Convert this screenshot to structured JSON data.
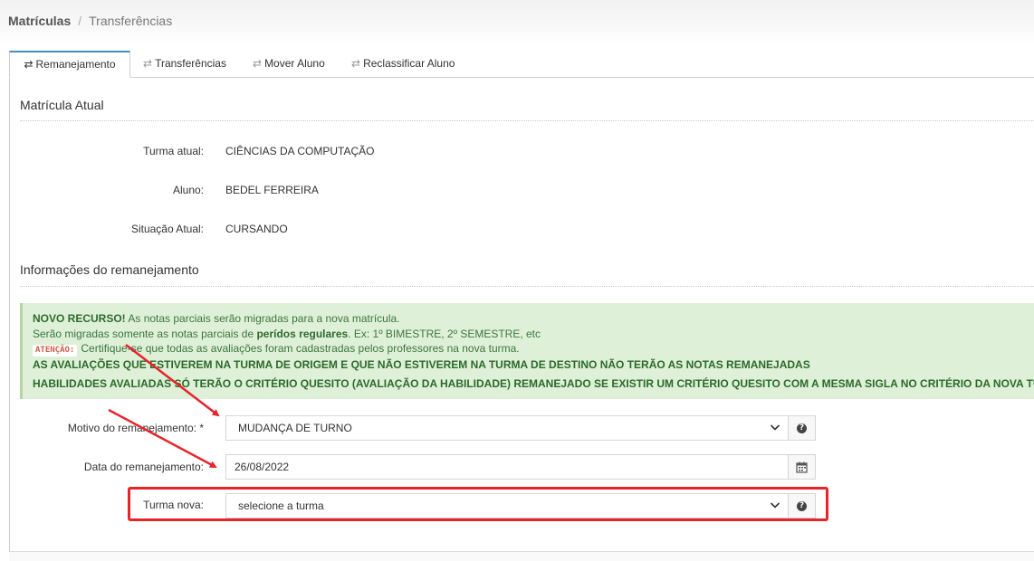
{
  "breadcrumb": {
    "root": "Matrículas",
    "current": "Transferências"
  },
  "tabs": [
    {
      "label": "Remanejamento",
      "active": true
    },
    {
      "label": "Transferências",
      "active": false
    },
    {
      "label": "Mover Aluno",
      "active": false
    },
    {
      "label": "Reclassificar Aluno",
      "active": false
    }
  ],
  "current_enrollment": {
    "title": "Matrícula Atual",
    "fields": [
      {
        "label": "Turma atual:",
        "value": "CIÊNCIAS DA COMPUTAÇÃO"
      },
      {
        "label": "Aluno:",
        "value": "BEDEL FERREIRA"
      },
      {
        "label": "Situação Atual:",
        "value": "CURSANDO"
      }
    ]
  },
  "relocation": {
    "title": "Informações do remanejamento",
    "alert": {
      "line1_bold": "NOVO RECURSO!",
      "line1_rest": " As notas parciais serão migradas para a nova matrícula.",
      "line2_prefix": "Serão migradas somente as notas parciais de ",
      "line2_bold": "perídos regulares",
      "line2_suffix": ". Ex: 1º BIMESTRE, 2º SEMESTRE, etc",
      "badge": "ATENÇÃO:",
      "line3": "Certifique-se que todas as avaliações foram cadastradas pelos professores na nova turma.",
      "line4": "AS AVALIAÇÕES QUE ESTIVEREM NA TURMA DE ORIGEM E QUE NÃO ESTIVEREM NA TURMA DE DESTINO NÃO TERÃO AS NOTAS REMANEJADAS",
      "line5": "HABILIDADES AVALIADAS SÓ TERÃO O CRITÉRIO QUESITO (AVALIAÇÃO DA HABILIDADE) REMANEJADO SE EXISTIR UM CRITÉRIO QUESITO COM A MESMA SIGLA NO CRITÉRIO DA NOVA TURMA"
    },
    "motivo": {
      "label": "Motivo do remanejamento: *",
      "value": "MUDANÇA DE TURNO"
    },
    "data": {
      "label": "Data do remanejamento:",
      "value": "26/08/2022"
    },
    "turma_nova": {
      "label": "Turma nova:",
      "value": "selecione a turma"
    }
  },
  "colors": {
    "accent": "#438eb9",
    "annotation": "#e8232a",
    "alert_bg": "#dff0d8"
  }
}
